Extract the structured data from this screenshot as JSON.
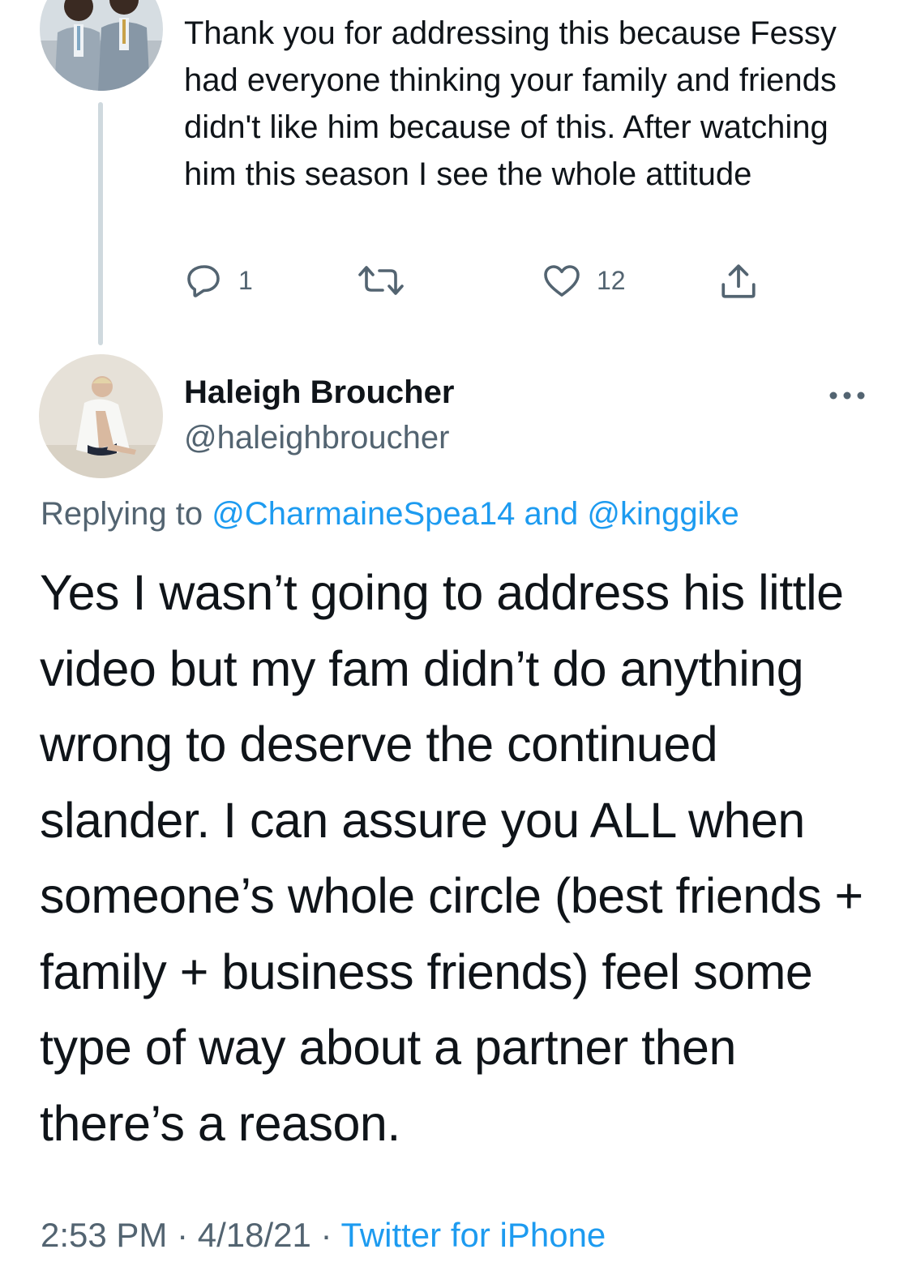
{
  "parent_tweet": {
    "text": "Thank you for addressing this because Fessy had everyone thinking your family and friends didn't like him because of this. After watching him this season I see the whole attitude",
    "reply_count": "1",
    "retweet_count": "",
    "like_count": "12"
  },
  "main_tweet": {
    "display_name": "Haleigh Broucher",
    "handle": "@haleighbroucher",
    "replying_prefix": "Replying to ",
    "replying_user_1": "@CharmaineSpea14",
    "replying_and": " and ",
    "replying_user_2": "@kinggike",
    "text": "Yes I wasn’t going to address his little video but my fam didn’t do anything wrong to deserve the continued slander. I can assure you ALL when someone’s whole circle (best friends + family + business friends) feel some type of way about a partner then there’s a reason.",
    "time": "2:53 PM",
    "separator": " · ",
    "date": "4/18/21",
    "source": "Twitter for iPhone"
  },
  "icons": {
    "reply": "reply-icon",
    "retweet": "retweet-icon",
    "like": "heart-icon",
    "share": "share-icon",
    "more": "more-icon"
  },
  "colors": {
    "text": "#0f1419",
    "secondary": "#536471",
    "link": "#1d9bf0",
    "thread_line": "#cfd9de"
  }
}
